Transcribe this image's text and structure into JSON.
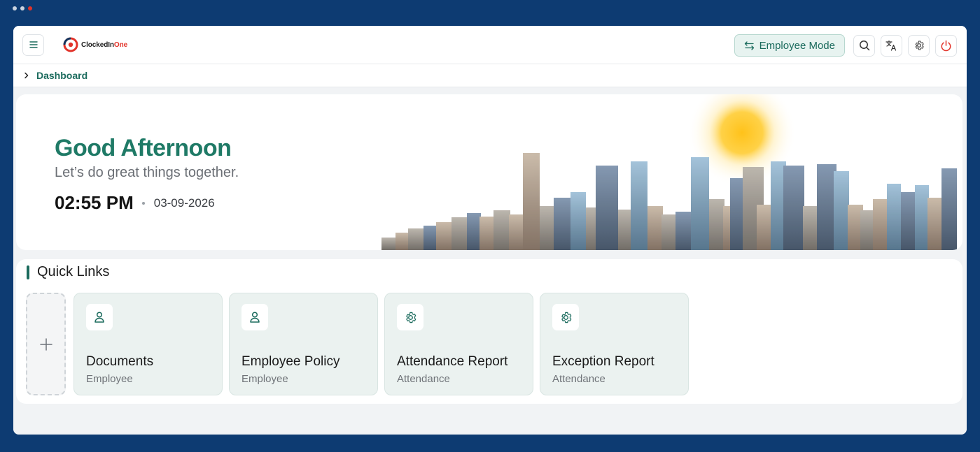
{
  "colors": {
    "frame_bg": "#0d3b72",
    "brand_green": "#1f7a66",
    "accent_red": "#e2332a",
    "card_bg": "#ebf2f0"
  },
  "header": {
    "menu_icon": "hamburger-icon",
    "logo": {
      "brand_main": "ClockedIn",
      "brand_accent": "One",
      "icon": "target-logo-icon"
    },
    "mode_button": {
      "label": "Employee Mode",
      "icon": "swap-arrows-icon"
    },
    "actions": [
      {
        "name": "search",
        "icon": "search-icon"
      },
      {
        "name": "language",
        "icon": "translate-icon"
      },
      {
        "name": "settings",
        "icon": "gear-icon"
      },
      {
        "name": "logout",
        "icon": "power-icon"
      }
    ]
  },
  "breadcrumb": {
    "icon": "chevron-right-icon",
    "current": "Dashboard"
  },
  "hero": {
    "greeting": "Good Afternoon",
    "tagline": "Let’s do great things together.",
    "time": "02:55 PM",
    "date": "03-09-2026"
  },
  "quick_links": {
    "title": "Quick Links",
    "add_icon": "plus-icon",
    "items": [
      {
        "title": "Documents",
        "subtitle": "Employee",
        "icon": "user-icon"
      },
      {
        "title": "Employee Policy",
        "subtitle": "Employee",
        "icon": "user-icon"
      },
      {
        "title": "Attendance Report",
        "subtitle": "Attendance",
        "icon": "gear-icon"
      },
      {
        "title": "Exception Report",
        "subtitle": "Attendance",
        "icon": "gear-icon"
      }
    ]
  }
}
